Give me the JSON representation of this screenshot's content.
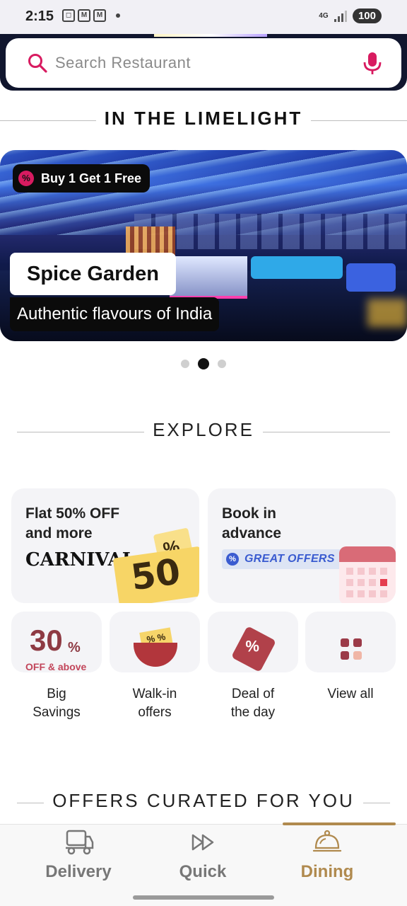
{
  "status_bar": {
    "time": "2:15",
    "notif_icons": [
      "screenshot-icon",
      "mail-icon",
      "mail-icon"
    ],
    "network": "4G",
    "battery": "100"
  },
  "search": {
    "placeholder": "Search Restaurant",
    "value": ""
  },
  "sections": {
    "limelight": "IN THE LIMELIGHT",
    "explore": "EXPLORE",
    "curated": "OFFERS CURATED FOR YOU"
  },
  "banner": {
    "offer": "Buy 1 Get 1 Free",
    "offer_icon": "%",
    "restaurant": "Spice Garden",
    "tagline": "Authentic flavours of India",
    "carousel_count": 3,
    "carousel_active": 2
  },
  "explore": {
    "big_cards": [
      {
        "title_line1": "Flat 50% OFF",
        "title_line2": "and more",
        "brand": "CARNIVAL",
        "ticket_number": "50",
        "ticket_small": "%"
      },
      {
        "title_line1": "Book in",
        "title_line2": "advance",
        "badge": "GREAT OFFERS",
        "badge_icon": "%"
      }
    ],
    "small_cards": [
      {
        "label_line1": "Big",
        "label_line2": "Savings",
        "art_big": "30",
        "art_pct": "%",
        "art_sub": "OFF & above"
      },
      {
        "label_line1": "Walk-in",
        "label_line2": "offers",
        "art_text": "% %"
      },
      {
        "label_line1": "Deal of",
        "label_line2": "the day",
        "art_text": "%"
      },
      {
        "label_line1": "View all",
        "label_line2": ""
      }
    ]
  },
  "bottom_nav": {
    "items": [
      {
        "label": "Delivery",
        "icon": "truck-icon"
      },
      {
        "label": "Quick",
        "icon": "fast-forward-icon"
      },
      {
        "label": "Dining",
        "icon": "cloche-icon",
        "active": true
      }
    ]
  },
  "colors": {
    "accent_pink": "#d81b60",
    "dining_gold": "#b08a4e",
    "header_navy": "#11162e"
  }
}
